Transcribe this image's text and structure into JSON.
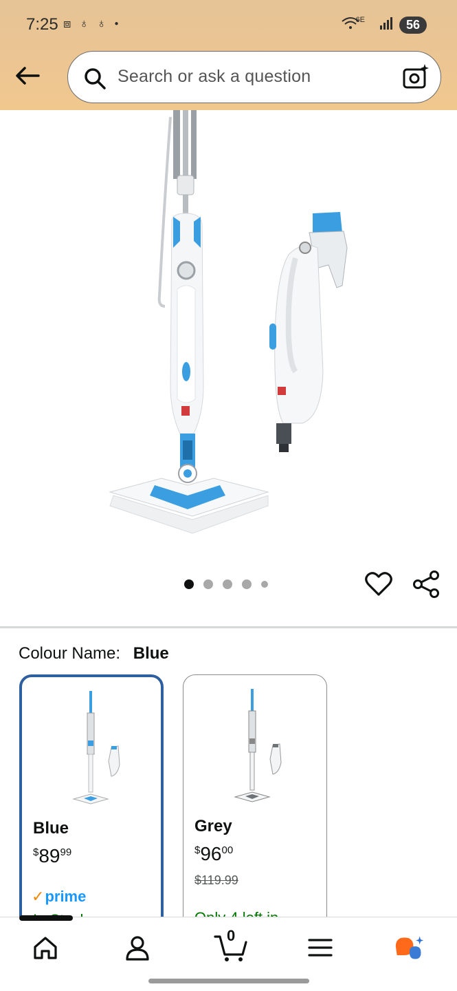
{
  "status_bar": {
    "time": "7:25",
    "left_icons": [
      "screenshot-icon",
      "notification-icon",
      "notification-icon",
      "dot-icon"
    ],
    "network": "6E",
    "battery": "56"
  },
  "header": {
    "back_icon": "arrow-left-icon",
    "search": {
      "placeholder": "Search or ask a question"
    },
    "camera_icon": "camera-sparkle-icon"
  },
  "product": {
    "image_alt": "BISSELL PowerEdge Lift-Off steam mop",
    "carousel": {
      "total_dots": 5,
      "active_index": 0
    }
  },
  "actions": {
    "wishlist_icon": "heart-icon",
    "share_icon": "share-icon"
  },
  "colour": {
    "label": "Colour Name:",
    "selected_value": "Blue",
    "variants": [
      {
        "name": "Blue",
        "price_symbol": "$",
        "price_whole": "89",
        "price_fraction": "99",
        "prime_label": "prime",
        "stock": "In Stock",
        "selected": true
      },
      {
        "name": "Grey",
        "price_symbol": "$",
        "price_whole": "96",
        "price_fraction": "00",
        "list_price": "$119.99",
        "stock": "Only 4 left in",
        "selected": false
      }
    ]
  },
  "bottom_nav": {
    "items": [
      "home-icon",
      "account-icon",
      "cart-icon",
      "menu-icon",
      "rufus-icon"
    ],
    "cart_count": "0"
  },
  "colors": {
    "header_bg": "#ecc592",
    "selected_border": "#2e5f9e",
    "prime_blue": "#1a98ff",
    "in_stock_green": "#007600",
    "mop_accent": "#3a9ee0"
  }
}
